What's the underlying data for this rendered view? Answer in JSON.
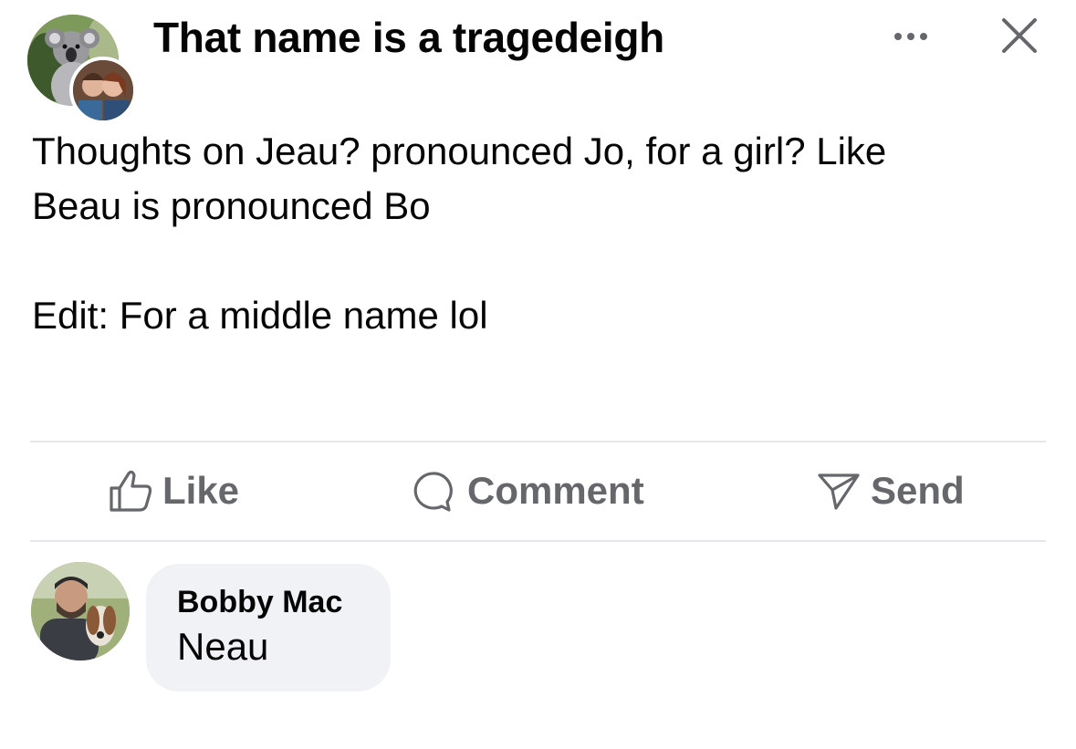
{
  "header": {
    "title": "That name is a tragedeigh",
    "group_avatar_icon": "koala-group-photo-icon",
    "user_avatar_icon": "user-profile-photo-icon",
    "more_icon": "more-options-icon",
    "close_icon": "close-icon"
  },
  "post": {
    "line1": "Thoughts on Jeau? pronounced Jo, for a girl? Like",
    "line2": "Beau is pronounced Bo",
    "edit": "Edit: For a middle name lol"
  },
  "actions": {
    "like_label": "Like",
    "comment_label": "Comment",
    "send_label": "Send",
    "like_icon": "thumbs-up-icon",
    "comment_icon": "speech-bubble-icon",
    "send_icon": "paper-plane-icon"
  },
  "comment": {
    "author": "Bobby Mac",
    "text": "Neau",
    "avatar_icon": "commenter-photo-icon"
  },
  "colors": {
    "text": "#050505",
    "secondary_text": "#65676b",
    "bubble": "#f0f2f5",
    "divider": "#e6e7ea"
  }
}
